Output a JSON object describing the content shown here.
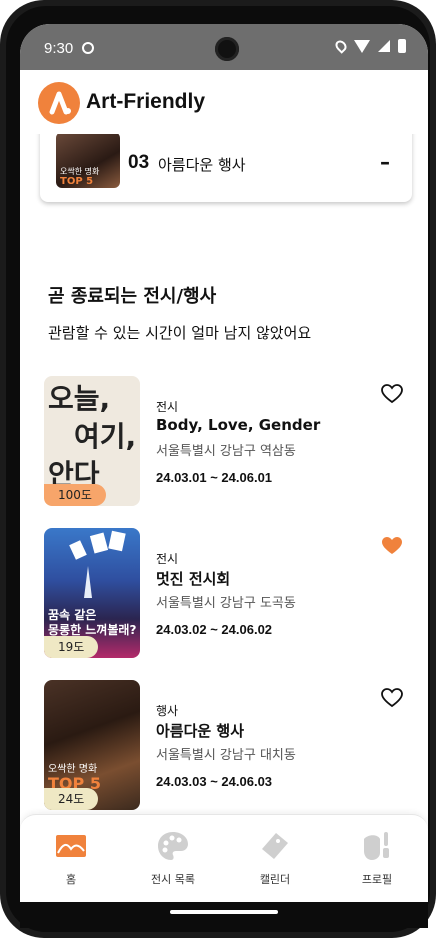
{
  "status_bar": {
    "time": "9:30"
  },
  "app": {
    "title": "Art-Friendly",
    "accent": "#f0823c"
  },
  "top_ranked": {
    "rank": "03",
    "title": "아름다운 행사",
    "collapse": "–",
    "thumb_text": "오싹한 명화",
    "thumb_top": "TOP 5"
  },
  "section": {
    "title": "곧 종료되는 전시/행사",
    "subtitle": "관람할 수 있는 시간이 얼마 남지 않았어요"
  },
  "events": [
    {
      "category": "전시",
      "title": "Body, Love, Gender",
      "location": "서울특별시 강남구 역삼동",
      "dates": "24.03.01 ~ 24.06.01",
      "temperature": "100도",
      "liked": false,
      "poster_lines": [
        "오늘,",
        "여기,",
        "안다"
      ]
    },
    {
      "category": "전시",
      "title": "멋진 전시회",
      "location": "서울특별시 강남구 도곡동",
      "dates": "24.03.02 ~ 24.06.02",
      "temperature": "19도",
      "liked": true,
      "poster_lines": [
        "꿈속 같은",
        "몽롱한 느껴볼래?"
      ]
    },
    {
      "category": "행사",
      "title": "아름다운 행사",
      "location": "서울특별시 강남구 대치동",
      "dates": "24.03.03 ~ 24.06.03",
      "temperature": "24도",
      "liked": false,
      "poster_lines": [
        "오싹한 명화",
        "TOP 5"
      ]
    }
  ],
  "nav": [
    {
      "label": "홈",
      "icon": "home-landscape-icon",
      "active": true
    },
    {
      "label": "전시 목록",
      "icon": "palette-icon",
      "active": false
    },
    {
      "label": "캘린더",
      "icon": "ticket-icon",
      "active": false
    },
    {
      "label": "프로필",
      "icon": "artist-profile-icon",
      "active": false
    }
  ],
  "colors": {
    "heart_liked": "#f0823c",
    "temp_hot": "#f7a56a",
    "temp_mild": "#efe8c4",
    "nav_inactive": "#cfcfcf"
  }
}
